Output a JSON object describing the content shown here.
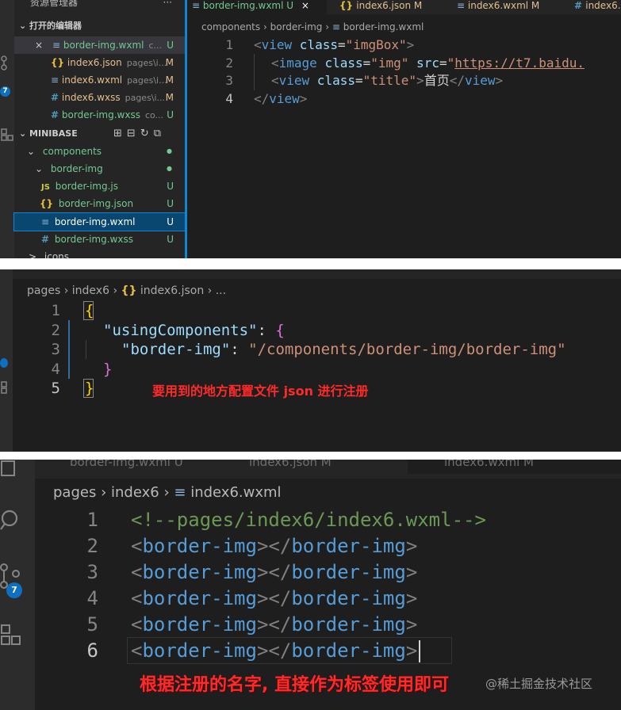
{
  "panel1": {
    "explorer_title": "资源管理器",
    "more_label": "···",
    "open_editors_label": "打开的编辑器",
    "open_editors": [
      {
        "close": "×",
        "icon": "≡",
        "name": "border-img.wxml",
        "hint": "c...",
        "status": "U"
      },
      {
        "icon": "{}",
        "name": "index6.json",
        "hint": "pages\\i...",
        "status": "M"
      },
      {
        "icon": "≡",
        "name": "index6.wxml",
        "hint": "pages\\i...",
        "status": "M"
      },
      {
        "icon": "#",
        "name": "index6.wxss",
        "hint": "pages\\i...",
        "status": "M"
      },
      {
        "icon": "#",
        "name": "border-img.wxss",
        "hint": "co...",
        "status": "U"
      }
    ],
    "project_label": "MINIBASE",
    "tree": [
      {
        "arrow": "⌄",
        "name": "components",
        "status": "●"
      },
      {
        "arrow": "⌄",
        "name": "border-img",
        "status": "●"
      },
      {
        "icon": "JS",
        "name": "border-img.js",
        "status": "U"
      },
      {
        "icon": "{}",
        "name": "border-img.json",
        "status": "U"
      },
      {
        "icon": "≡",
        "name": "border-img.wxml",
        "status": "U"
      },
      {
        "icon": "#",
        "name": "border-img.wxss",
        "status": "U"
      },
      {
        "arrow": ">",
        "name": "icons"
      }
    ],
    "badge": "7",
    "tabs": [
      {
        "label": "border-img.wxml",
        "status": "U",
        "close": "×"
      },
      {
        "label": "index6.json",
        "status": "M"
      },
      {
        "label": "index6.wxml",
        "status": "M"
      },
      {
        "label": "index6.w"
      }
    ],
    "breadcrumb": [
      "components",
      "border-img",
      "border-img.wxml"
    ],
    "line_numbers": [
      "1",
      "2",
      "3",
      "4"
    ],
    "code": {
      "l1_open": "<",
      "l1_tag": "view",
      "l1_attr": " class",
      "l1_eq": "=",
      "l1_val": "\"imgBox\"",
      "l1_close": ">",
      "l2_open": "<",
      "l2_tag": "image",
      "l2_attr1": " class",
      "l2_eq1": "=",
      "l2_val1": "\"img\"",
      "l2_attr2": " src",
      "l2_eq2": "=",
      "l2_q": "\"",
      "l2_url": "https://t7.baidu.",
      "l3_open": "<",
      "l3_tag": "view",
      "l3_attr": " class",
      "l3_eq": "=",
      "l3_val": "\"title\"",
      "l3_gt": ">",
      "l3_text": "首页",
      "l3_close_open": "</",
      "l3_close_tag": "view",
      "l3_close_gt": ">",
      "l4_open": "</",
      "l4_tag": "view",
      "l4_close": ">"
    }
  },
  "panel2": {
    "breadcrumb": [
      "pages",
      "index6",
      "index6.json",
      "..."
    ],
    "line_numbers": [
      "1",
      "2",
      "3",
      "4",
      "5"
    ],
    "code": {
      "l1": "{",
      "l2_key": "\"usingComponents\"",
      "l2_colon": ": ",
      "l2_brace": "{",
      "l3_key": "\"border-img\"",
      "l3_colon": ": ",
      "l3_val": "\"/components/border-img/border-img\"",
      "l4": "}",
      "l5": "}"
    },
    "note": "要用到的地方配置文件 json 进行注册"
  },
  "panel3": {
    "tabs": [
      "border-img.wxml U",
      "index6.json M",
      "index6.wxml M"
    ],
    "badge": "7",
    "breadcrumb": [
      "pages",
      "index6",
      "index6.wxml"
    ],
    "line_numbers": [
      "1",
      "2",
      "3",
      "4",
      "5",
      "6"
    ],
    "comment": "<!--pages/index6/index6.wxml-->",
    "component_line": {
      "open": "<",
      "tag": "border-img",
      "mid": "></",
      "close": ">"
    },
    "note": "根据注册的名字, 直接作为标签使用即可",
    "watermark": "@稀土掘金技术社区"
  },
  "colors": {
    "accent": "#0e86d4",
    "annotation": "#ff2a2a",
    "untracked": "#73c991",
    "modified": "#e2c08d"
  }
}
